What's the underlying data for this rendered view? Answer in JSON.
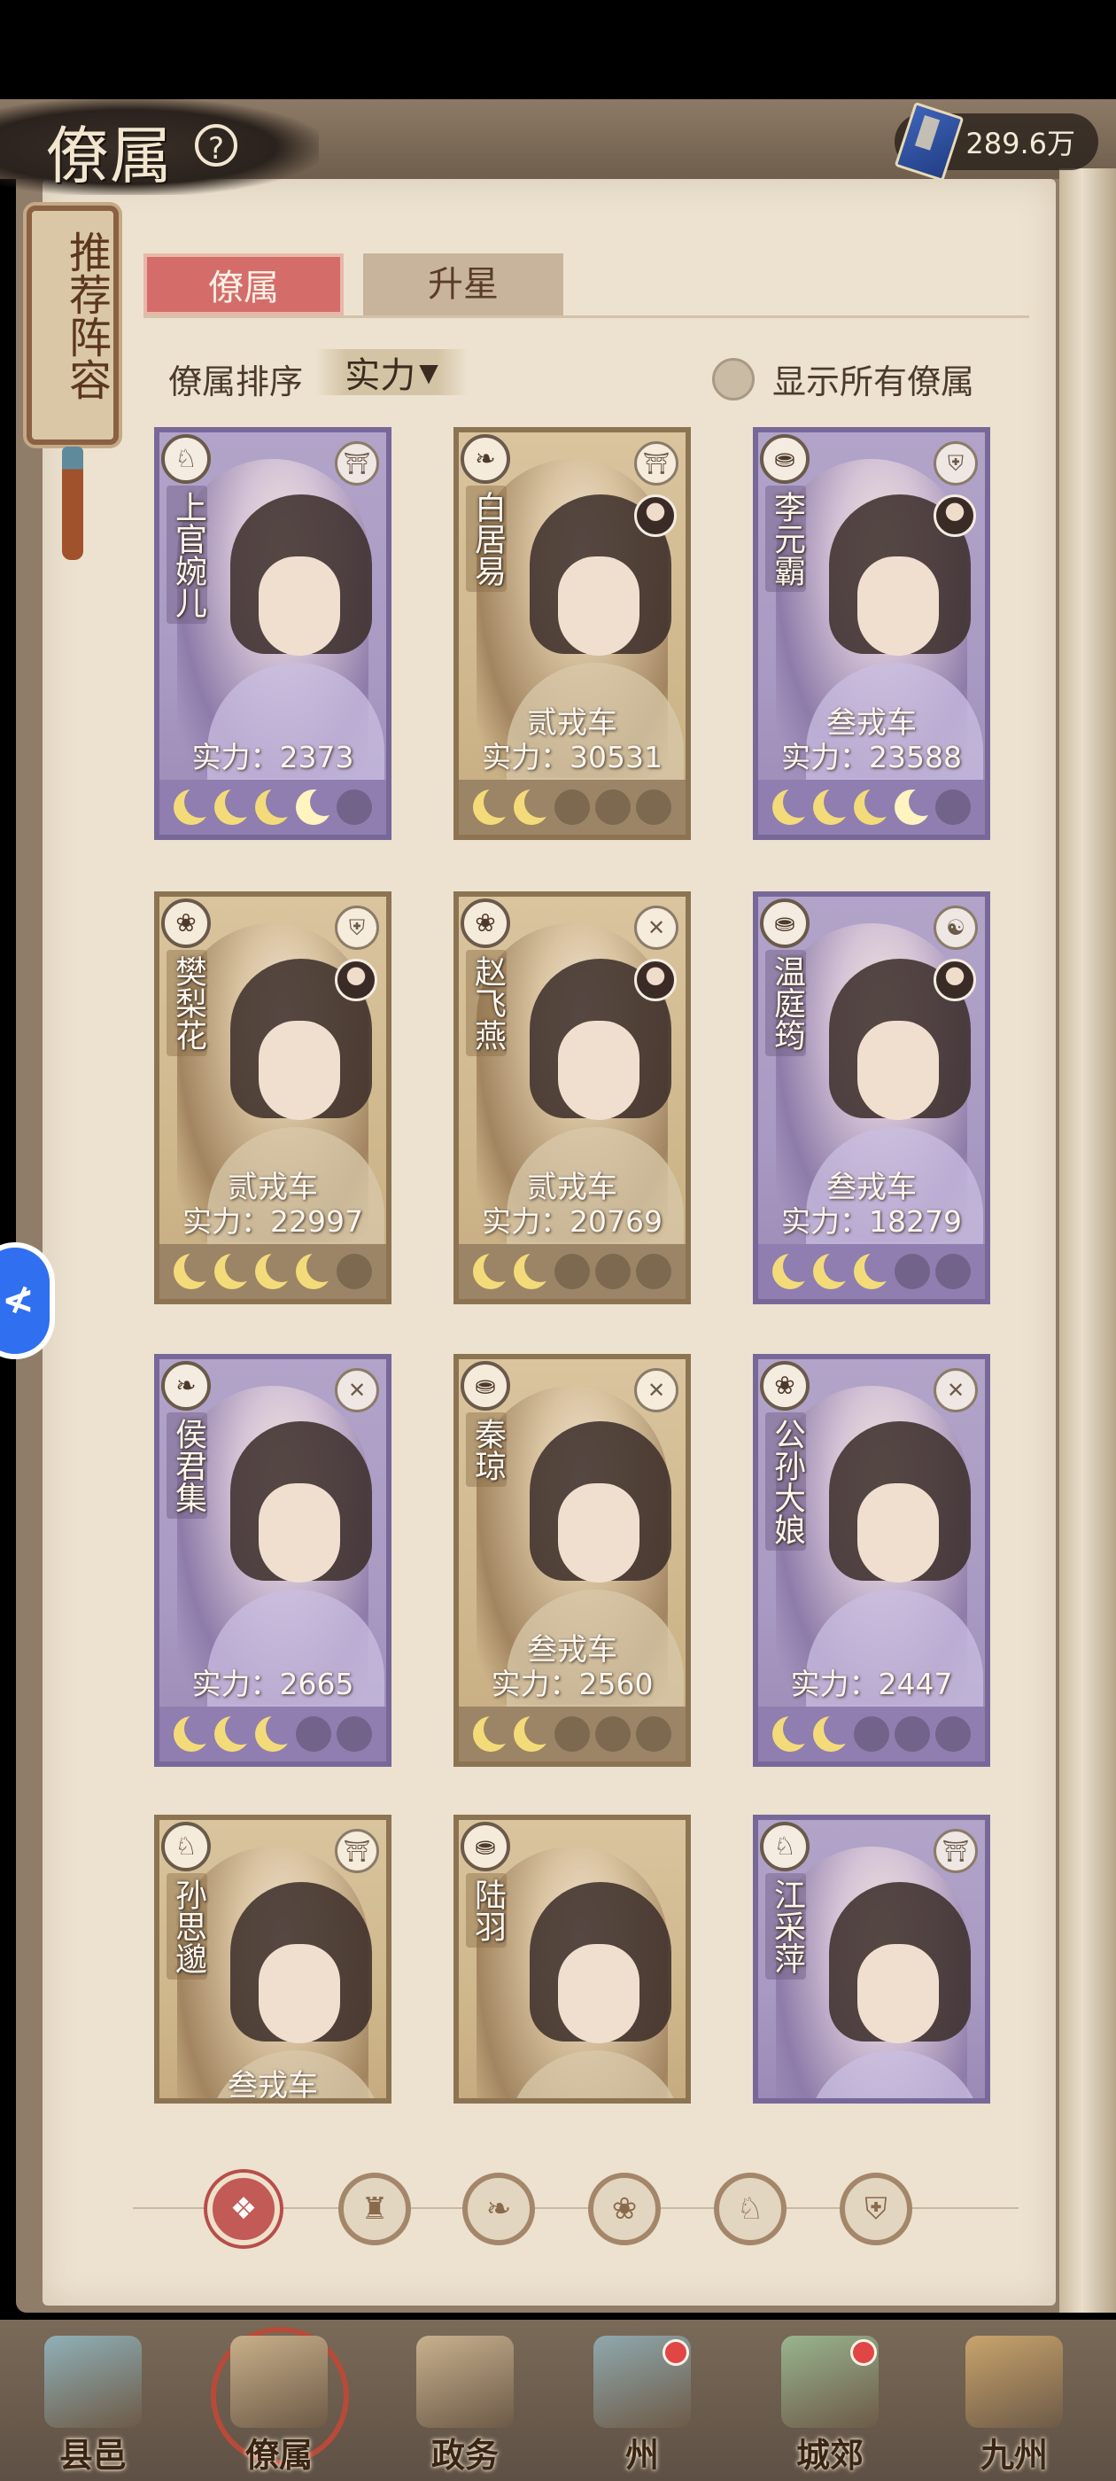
{
  "header": {
    "title": "僚属",
    "help_icon": "?",
    "currency_value": "289.6万"
  },
  "plaque": {
    "text": "推荐阵容"
  },
  "tabs": [
    {
      "label": "僚属",
      "active": true
    },
    {
      "label": "升星",
      "active": false
    }
  ],
  "sort": {
    "label": "僚属排序",
    "value": "实力",
    "caret": "▼"
  },
  "toggle": {
    "label": "显示所有僚属",
    "checked": false
  },
  "cards": [
    {
      "name": "上官婉儿",
      "rank": "",
      "power": "实力：2373",
      "style": "purple",
      "faction": "♘",
      "type": "⛩",
      "stars": 5,
      "moons": [
        "on",
        "on",
        "on",
        "half",
        "off"
      ]
    },
    {
      "name": "白居易",
      "rank": "贰戎车",
      "power": "实力：30531",
      "style": "gold",
      "faction": "❧",
      "type": "⛩",
      "stars": 5,
      "moons": [
        "on",
        "on",
        "off",
        "off",
        "off"
      ]
    },
    {
      "name": "李元霸",
      "rank": "叁戎车",
      "power": "实力：23588",
      "style": "purple",
      "faction": "⛂",
      "type": "⛨",
      "stars": 5,
      "moons": [
        "on",
        "on",
        "on",
        "half",
        "off"
      ]
    },
    {
      "name": "樊梨花",
      "rank": "贰戎车",
      "power": "实力：22997",
      "style": "gold",
      "faction": "❀",
      "type": "⛨",
      "stars": 5,
      "moons": [
        "on",
        "on",
        "on",
        "on",
        "off"
      ]
    },
    {
      "name": "赵飞燕",
      "rank": "贰戎车",
      "power": "实力：20769",
      "style": "gold",
      "faction": "❀",
      "type": "✕",
      "stars": 5,
      "moons": [
        "on",
        "on",
        "off",
        "off",
        "off"
      ]
    },
    {
      "name": "温庭筠",
      "rank": "叁戎车",
      "power": "实力：18279",
      "style": "purple",
      "faction": "⛂",
      "type": "☯",
      "stars": 5,
      "moons": [
        "on",
        "on",
        "on",
        "off",
        "off"
      ]
    },
    {
      "name": "侯君集",
      "rank": "",
      "power": "实力：2665",
      "style": "purple",
      "faction": "❧",
      "type": "✕",
      "stars": 5,
      "moons": [
        "on",
        "on",
        "on",
        "off",
        "off"
      ]
    },
    {
      "name": "秦琼",
      "rank": "叁戎车",
      "power": "实力：2560",
      "style": "gold",
      "faction": "⛂",
      "type": "✕",
      "stars": 5,
      "moons": [
        "on",
        "on",
        "off",
        "off",
        "off"
      ]
    },
    {
      "name": "公孙大娘",
      "rank": "",
      "power": "实力：2447",
      "style": "purple",
      "faction": "❀",
      "type": "✕",
      "stars": 5,
      "moons": [
        "on",
        "on",
        "off",
        "off",
        "off"
      ]
    },
    {
      "name": "孙思邈",
      "rank": "叁戎车",
      "power": "",
      "style": "gold",
      "faction": "♘",
      "type": "⛩",
      "stars": 0,
      "moons": []
    },
    {
      "name": "陆羽",
      "rank": "",
      "power": "",
      "style": "gold",
      "faction": "⛂",
      "type": "",
      "stars": 0,
      "moons": []
    },
    {
      "name": "江采萍",
      "rank": "",
      "power": "",
      "style": "purple",
      "faction": "♘",
      "type": "⛩",
      "stars": 0,
      "moons": []
    }
  ],
  "filters": [
    {
      "name": "all-filter-icon",
      "glyph": "❖",
      "active": true
    },
    {
      "name": "hat-filter-icon",
      "glyph": "♜",
      "active": false
    },
    {
      "name": "rabbit-filter-icon",
      "glyph": "❧",
      "active": false
    },
    {
      "name": "fan-filter-icon",
      "glyph": "❀",
      "active": false
    },
    {
      "name": "horse-filter-icon",
      "glyph": "♘",
      "active": false
    },
    {
      "name": "shield-filter-icon",
      "glyph": "⛨",
      "active": false
    }
  ],
  "nav": [
    {
      "label": "县邑",
      "active": false,
      "badge": false,
      "color": "#8fb1b8"
    },
    {
      "label": "僚属",
      "active": true,
      "badge": false,
      "color": "#c9b08a"
    },
    {
      "label": "政务",
      "active": false,
      "badge": false,
      "color": "#c7b18e"
    },
    {
      "label": "州",
      "active": false,
      "badge": true,
      "color": "#8fa9ae"
    },
    {
      "label": "城郊",
      "active": false,
      "badge": true,
      "color": "#98b58f"
    },
    {
      "label": "九州",
      "active": false,
      "badge": false,
      "color": "#c9a46c"
    }
  ]
}
